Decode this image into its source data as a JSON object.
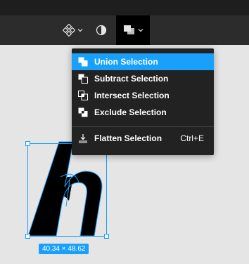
{
  "toolbar": {
    "component_icon": "component-icon",
    "mask_icon": "mask-icon",
    "boolean_icon": "boolean-union-icon"
  },
  "menu": {
    "items": [
      {
        "label": "Union Selection",
        "icon": "union-icon",
        "active": true
      },
      {
        "label": "Subtract Selection",
        "icon": "subtract-icon",
        "active": false
      },
      {
        "label": "Intersect Selection",
        "icon": "intersect-icon",
        "active": false
      },
      {
        "label": "Exclude Selection",
        "icon": "exclude-icon",
        "active": false
      }
    ],
    "flatten": {
      "label": "Flatten Selection",
      "shortcut": "Ctrl+E",
      "icon": "flatten-icon"
    }
  },
  "canvas": {
    "size_label": "40.34 × 48.62"
  },
  "colors": {
    "accent": "#18a0fb",
    "menu_bg": "#222222",
    "toolbar_bg": "#2c2c2c",
    "canvas_bg": "#e5e5e5"
  }
}
